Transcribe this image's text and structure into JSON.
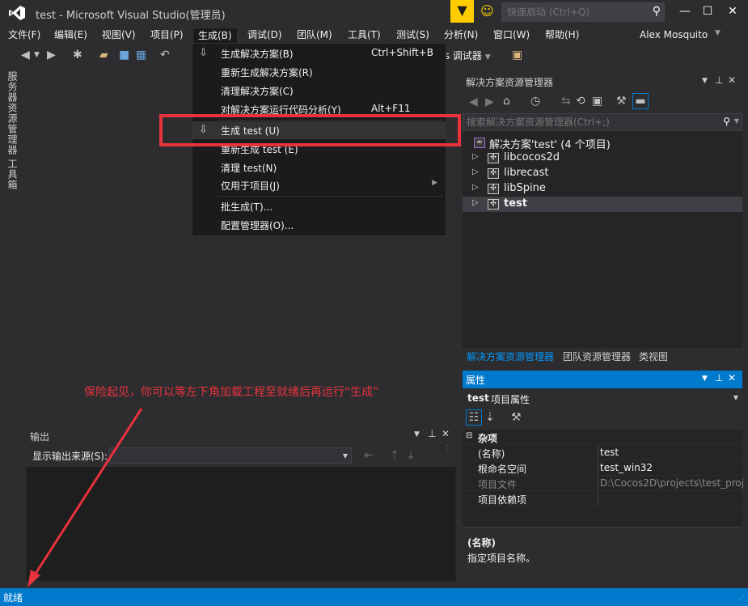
{
  "window": {
    "title": "test - Microsoft Visual Studio(管理员)",
    "quick_launch_placeholder": "快速启动 (Ctrl+Q)",
    "user": "Alex Mosquito"
  },
  "menu": {
    "items": [
      "文件(F)",
      "编辑(E)",
      "视图(V)",
      "项目(P)",
      "生成(B)",
      "调试(D)",
      "团队(M)",
      "工具(T)",
      "测试(S)",
      "分析(N)",
      "窗口(W)",
      "帮助(H)"
    ]
  },
  "toolbar": {
    "platform_label": "ws 调试器"
  },
  "left_tabs": [
    "服务器资源管理器",
    "工具箱"
  ],
  "build_menu": {
    "items": [
      {
        "label": "生成解决方案(B)",
        "shortcut": "Ctrl+Shift+B"
      },
      {
        "label": "重新生成解决方案(R)",
        "shortcut": ""
      },
      {
        "label": "清理解决方案(C)",
        "shortcut": ""
      },
      {
        "label": "对解决方案运行代码分析(Y)",
        "shortcut": "Alt+F11"
      },
      {
        "label": "生成 test (U)",
        "shortcut": ""
      },
      {
        "label": "重新生成 test (E)",
        "shortcut": ""
      },
      {
        "label": "清理 test(N)",
        "shortcut": ""
      },
      {
        "label": "仅用于项目(J)",
        "shortcut": ""
      },
      {
        "label": "批生成(T)...",
        "shortcut": ""
      },
      {
        "label": "配置管理器(O)...",
        "shortcut": ""
      }
    ]
  },
  "solution_explorer": {
    "title": "解决方案资源管理器",
    "search_placeholder": "搜索解决方案资源管理器(Ctrl+;)",
    "root": "解决方案'test' (4 个项目)",
    "projects": [
      "libcocos2d",
      "librecast",
      "libSpine",
      "test"
    ],
    "tabs": [
      "解决方案资源管理器",
      "团队资源管理器",
      "类视图"
    ]
  },
  "properties": {
    "title": "属性",
    "object_name": "test",
    "object_type": "项目属性",
    "category": "杂项",
    "rows": [
      {
        "name": "(名称)",
        "value": "test"
      },
      {
        "name": "根命名空间",
        "value": "test_win32"
      },
      {
        "name": "项目文件",
        "value": "D:\\Cocos2D\\projects\\test_proj"
      },
      {
        "name": "项目依赖项",
        "value": ""
      }
    ],
    "desc_title": "(名称)",
    "desc_text": "指定项目名称。"
  },
  "output": {
    "title": "输出",
    "source_label": "显示输出来源(S):"
  },
  "annotation": "保险起见，你可以等左下角加载工程至就绪后再运行“生成”",
  "status": "就绪",
  "colors": {
    "accent": "#007acc",
    "annotation_red": "#e8323c",
    "notification_yellow": "#ffcc00"
  }
}
